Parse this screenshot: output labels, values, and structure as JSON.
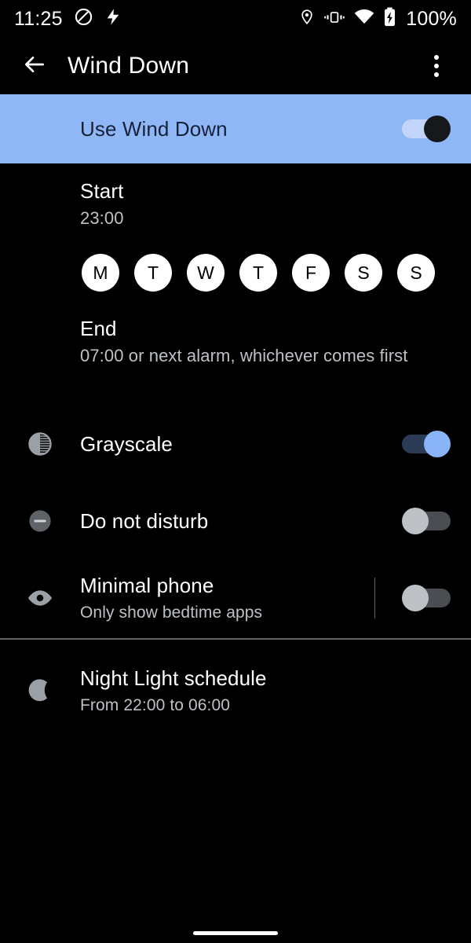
{
  "status_bar": {
    "time": "11:25",
    "battery_percent": "100%",
    "left_icons": [
      "dnd-icon",
      "flash-icon"
    ],
    "right_icons": [
      "location-icon",
      "vibrate-icon",
      "wifi-icon",
      "battery-charging-icon"
    ]
  },
  "app_bar": {
    "back_label": "back-arrow",
    "title": "Wind Down",
    "overflow_label": "more-options"
  },
  "master_toggle": {
    "label": "Use Wind Down",
    "state": "on"
  },
  "schedule": {
    "start": {
      "title": "Start",
      "value": "23:00"
    },
    "end": {
      "title": "End",
      "value": "07:00 or next alarm, whichever comes first"
    },
    "days": [
      {
        "letter": "M",
        "name": "monday",
        "selected": true
      },
      {
        "letter": "T",
        "name": "tuesday",
        "selected": true
      },
      {
        "letter": "W",
        "name": "wednesday",
        "selected": true
      },
      {
        "letter": "T",
        "name": "thursday",
        "selected": true
      },
      {
        "letter": "F",
        "name": "friday",
        "selected": true
      },
      {
        "letter": "S",
        "name": "saturday",
        "selected": true
      },
      {
        "letter": "S",
        "name": "sunday",
        "selected": true
      }
    ]
  },
  "settings": {
    "grayscale": {
      "title": "Grayscale",
      "subtitle": "",
      "icon": "grayscale-icon",
      "state": "on"
    },
    "do_not_disturb": {
      "title": "Do not disturb",
      "subtitle": "",
      "icon": "do-not-disturb-icon",
      "state": "off"
    },
    "minimal_phone": {
      "title": "Minimal phone",
      "subtitle": "Only show bedtime apps",
      "icon": "eye-icon",
      "state": "off"
    },
    "night_light": {
      "title": "Night Light schedule",
      "subtitle": "From 22:00 to 06:00",
      "icon": "moon-icon"
    }
  },
  "colors": {
    "accent_blue": "#8AB4F8",
    "banner_blue": "#8FB6F5",
    "background": "#000000",
    "secondary_text": "#bdc1c6"
  }
}
